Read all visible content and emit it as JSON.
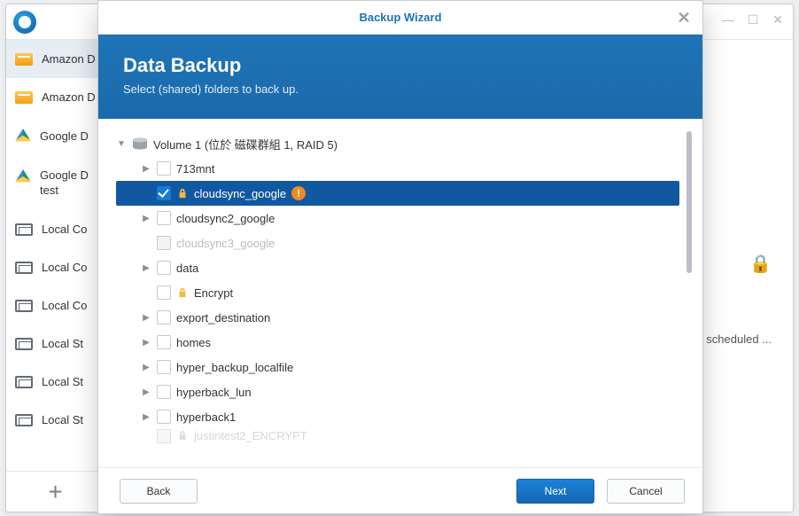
{
  "modal": {
    "title": "Backup Wizard",
    "heading": "Data Backup",
    "subtitle": "Select (shared) folders to back up.",
    "volume_label": "Volume 1 (位於 磁碟群組 1, RAID 5)",
    "items": {
      "i0": {
        "label": "713mnt"
      },
      "i1": {
        "label": "cloudsync_google"
      },
      "i2": {
        "label": "cloudsync2_google"
      },
      "i3": {
        "label": "cloudsync3_google"
      },
      "i4": {
        "label": "data"
      },
      "i5": {
        "label": "Encrypt"
      },
      "i6": {
        "label": "export_destination"
      },
      "i7": {
        "label": "homes"
      },
      "i8": {
        "label": "hyper_backup_localfile"
      },
      "i9": {
        "label": "hyperback_lun"
      },
      "i10": {
        "label": "hyperback1"
      },
      "i11": {
        "label": "justintest2_ENCRYPT"
      }
    },
    "buttons": {
      "back": "Back",
      "next": "Next",
      "cancel": "Cancel"
    }
  },
  "sidebar": {
    "items": {
      "s0": {
        "label": "Amazon D"
      },
      "s1": {
        "label": "Amazon D"
      },
      "s2": {
        "label": "Google D"
      },
      "s3": {
        "label": "Google D test"
      },
      "s4": {
        "label": "Local Co"
      },
      "s5": {
        "label": "Local Co"
      },
      "s6": {
        "label": "Local Co"
      },
      "s7": {
        "label": "Local St"
      },
      "s8": {
        "label": "Local St"
      },
      "s9": {
        "label": "Local St"
      }
    },
    "add_glyph": "+"
  },
  "bg": {
    "note": "scheduled ..."
  }
}
